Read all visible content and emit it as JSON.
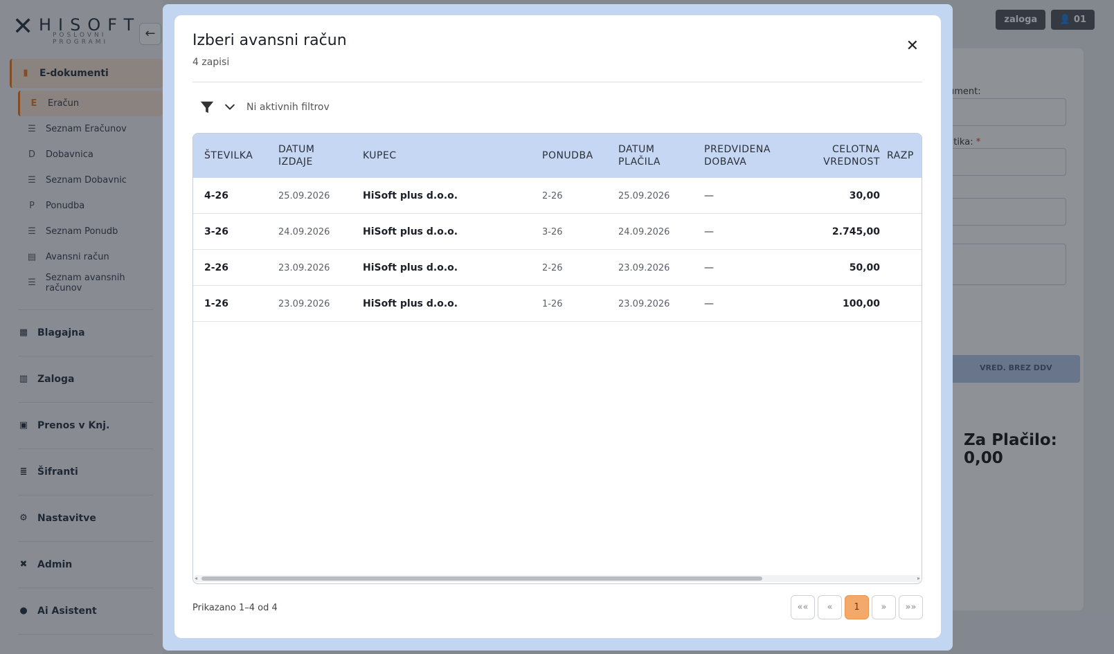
{
  "app": {
    "logo_word": "HISOFT",
    "logo_sub": "POSLOVNI PROGRAMI",
    "badges": [
      "zaloga",
      "01"
    ]
  },
  "sidebar": {
    "edokumenti": "E-dokumenti",
    "sub_items": [
      {
        "icon": "E",
        "label": "Eračun"
      },
      {
        "icon": "list",
        "label": "Seznam Eračunov"
      },
      {
        "icon": "D",
        "label": "Dobavnica"
      },
      {
        "icon": "list",
        "label": "Seznam Dobavnic"
      },
      {
        "icon": "P",
        "label": "Ponudba"
      },
      {
        "icon": "list",
        "label": "Seznam Ponudb"
      },
      {
        "icon": "doc",
        "label": "Avansni račun"
      },
      {
        "icon": "list",
        "label": "Seznam avansnih računov"
      }
    ],
    "groups": [
      "Blagajna",
      "Zaloga",
      "Prenos v Knj.",
      "Šifranti",
      "Nastavitve",
      "Admin",
      "Ai Asistent"
    ]
  },
  "right_panel": {
    "label1": "ument:",
    "label2": "litika:",
    "required": "*",
    "col_header": "VRED. BREZ DDV",
    "total": "Za Plačilo: 0,00"
  },
  "modal": {
    "title": "Izberi avansni račun",
    "count": "4 zapisi",
    "filter_status": "Ni aktivnih filtrov",
    "columns": [
      "ŠTEVILKA",
      "DATUM IZDAJE",
      "KUPEC",
      "PONUDBA",
      "DATUM PLAČILA",
      "PREDVIDENA DOBAVA",
      "CELOTNA VREDNOST",
      "RAZP"
    ],
    "rows": [
      {
        "stevilka": "4-26",
        "datum": "25.09.2026",
        "kupec": "HiSoft plus d.o.o.",
        "ponudba": "2-26",
        "placilo": "25.09.2026",
        "dobava": "—",
        "vrednost": "30,00"
      },
      {
        "stevilka": "3-26",
        "datum": "24.09.2026",
        "kupec": "HiSoft plus d.o.o.",
        "ponudba": "3-26",
        "placilo": "24.09.2026",
        "dobava": "—",
        "vrednost": "2.745,00"
      },
      {
        "stevilka": "2-26",
        "datum": "23.09.2026",
        "kupec": "HiSoft plus d.o.o.",
        "ponudba": "2-26",
        "placilo": "23.09.2026",
        "dobava": "—",
        "vrednost": "50,00"
      },
      {
        "stevilka": "1-26",
        "datum": "23.09.2026",
        "kupec": "HiSoft plus d.o.o.",
        "ponudba": "1-26",
        "placilo": "23.09.2026",
        "dobava": "—",
        "vrednost": "100,00"
      }
    ],
    "footer": "Prikazano 1–4 od 4",
    "pager": [
      "««",
      "«",
      "1",
      "»",
      "»»"
    ]
  }
}
